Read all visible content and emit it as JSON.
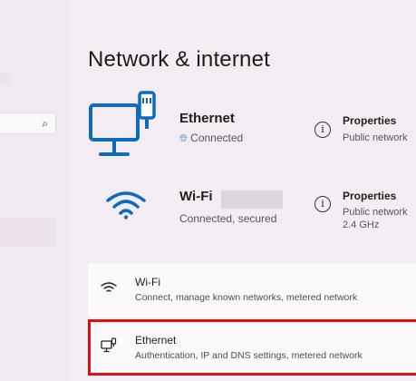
{
  "sidebar": {
    "search_icon": "search-icon"
  },
  "page": {
    "title": "Network & internet"
  },
  "ethernet_status": {
    "name": "Ethernet",
    "status": "Connected",
    "properties_label": "Properties",
    "properties_sub": "Public network"
  },
  "wifi_status": {
    "name": "Wi-Fi",
    "status": "Connected, secured",
    "properties_label": "Properties",
    "properties_sub_1": "Public network",
    "properties_sub_2": "2.4 GHz"
  },
  "cards": {
    "wifi": {
      "title": "Wi-Fi",
      "subtitle": "Connect, manage known networks, metered network"
    },
    "ethernet": {
      "title": "Ethernet",
      "subtitle": "Authentication, IP and DNS settings, metered network"
    }
  },
  "colors": {
    "accent": "#0f6cbd",
    "highlight": "#e01010"
  }
}
